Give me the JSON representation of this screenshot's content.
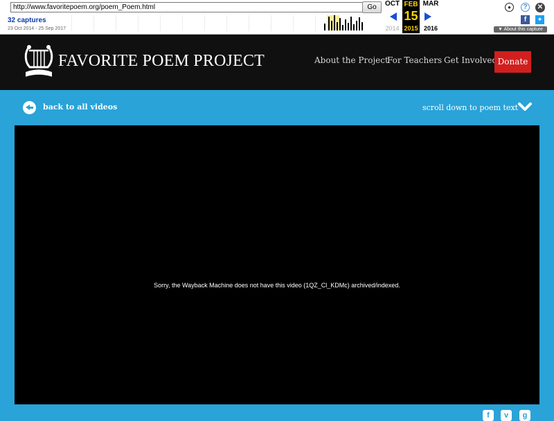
{
  "wayback": {
    "url": "http://www.favoritepoem.org/poem_Poem.html",
    "go_label": "Go",
    "captures": "32 captures",
    "range": "23 Oct 2014 - 25 Sep 2017",
    "prev": {
      "month": "OCT",
      "year": "2014"
    },
    "current": {
      "month": "FEB",
      "day": "15",
      "year": "2015"
    },
    "next": {
      "month": "MAR",
      "year": "2016"
    },
    "about_label": "About this capture",
    "icons": {
      "user": "user-icon",
      "help": "help-icon",
      "close": "close-icon",
      "facebook": "facebook-icon",
      "twitter": "twitter-icon"
    }
  },
  "header": {
    "logo_text": "FAVORITE POEM PROJECT",
    "nav": [
      "About the Project",
      "For Teachers",
      "Get Involved"
    ],
    "donate": "Donate"
  },
  "strip": {
    "back_label": "back to all videos",
    "scroll_label": "scroll down to poem text"
  },
  "video": {
    "message": "Sorry, the Wayback Machine does not have this video (1QZ_Cl_KDMc) archived/indexed."
  },
  "colors": {
    "page_bg": "#29a3d8",
    "header_bg": "#101010",
    "donate_bg": "#d11f1f",
    "calendar_highlight": "#ffd400"
  }
}
